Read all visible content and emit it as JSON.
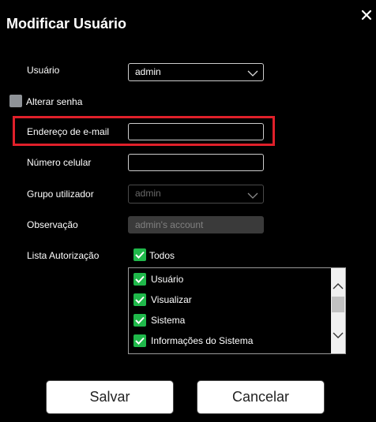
{
  "dialog": {
    "title": "Modificar Usuário",
    "close_icon": "close-icon"
  },
  "form": {
    "user_label": "Usuário",
    "user_value": "admin",
    "change_password_label": "Alterar senha",
    "email_label": "Endereço de e-mail",
    "email_value": "",
    "phone_label": "Número celular",
    "phone_value": "",
    "group_label": "Grupo utilizador",
    "group_value": "admin",
    "note_label": "Observação",
    "note_value": "admin's account",
    "permissions_label": "Lista Autorização",
    "all_label": "Todos"
  },
  "permissions": {
    "items": [
      {
        "label": "Usuário",
        "checked": true
      },
      {
        "label": "Visualizar",
        "checked": true
      },
      {
        "label": "Sistema",
        "checked": true
      },
      {
        "label": "Informações do Sistema",
        "checked": true
      }
    ]
  },
  "buttons": {
    "save": "Salvar",
    "cancel": "Cancelar"
  },
  "colors": {
    "highlight": "#e0202a",
    "check": "#1fb84a"
  }
}
